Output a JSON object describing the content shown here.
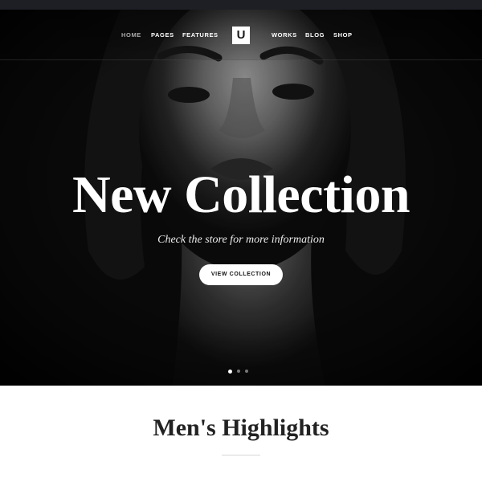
{
  "nav": {
    "left_items": [
      "HOME",
      "PAGES",
      "FEATURES"
    ],
    "right_items": [
      "WORKS",
      "BLOG",
      "SHOP"
    ],
    "active_item": "HOME",
    "logo_letter": "U"
  },
  "hero": {
    "title": "New Collection",
    "subtitle": "Check the store for more information",
    "button_label": "VIEW COLLECTION",
    "slider": {
      "slide_count": 3,
      "active_slide": 1
    }
  },
  "highlights": {
    "title": "Men's Highlights"
  },
  "colors": {
    "top_strip": "#1d1f24",
    "hero_background": "#0c0c0c",
    "text_light": "#ffffff",
    "nav_active": "#a9a9a9",
    "text_dark": "#222222",
    "page_background": "#ffffff"
  }
}
